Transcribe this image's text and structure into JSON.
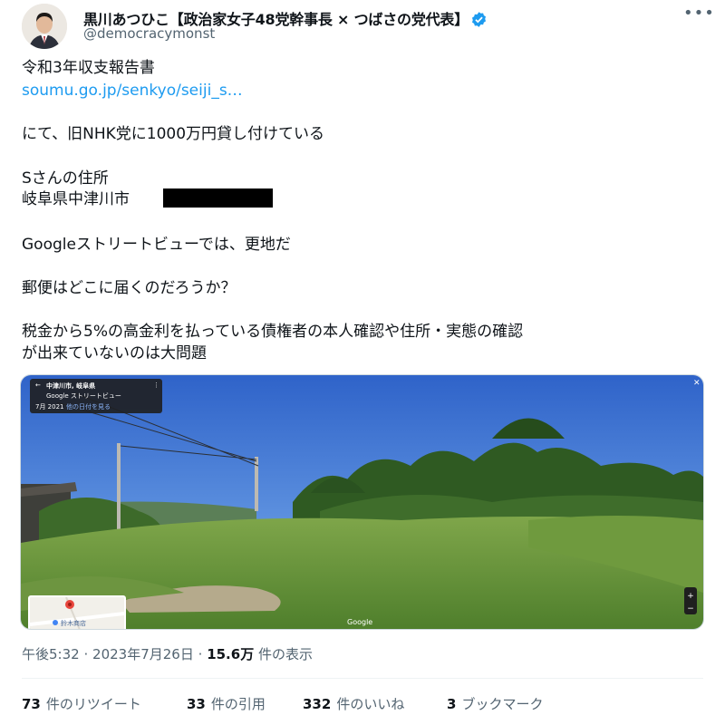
{
  "author": {
    "name": "黒川あつひこ【政治家女子48党幹事長 × つばさの党代表】",
    "handle": "@democracymonst",
    "verified_icon": "verified-badge-icon",
    "verified_color": "#1d9bf0"
  },
  "more_icon": "more-horizontal-icon",
  "post": {
    "line1": "令和3年収支報告書",
    "link": "soumu.go.jp/senkyo/seiji_s…",
    "line3": "にて、旧NHK党に1000万円貸し付けている",
    "line4": "Sさんの住所",
    "line5": "岐阜県中津川市",
    "line6": "Googleストリートビューでは、更地だ",
    "line7": "郵便はどこに届くのだろうか？",
    "line8": "税金から5%の高金利を払っている債権者の本人確認や住所・実態の確認",
    "line9": "が出来ていないのは大問題"
  },
  "media": {
    "place": "中津川市, 岐阜県",
    "provider": "Google ストリートビュー",
    "date": "7月 2021",
    "action": "他の日付を見る",
    "map_label": "鈴木商店",
    "watermark": "Google"
  },
  "meta": {
    "time": "午後5:32",
    "date": "2023年7月26日",
    "views": "15.6万",
    "views_label": "件の表示",
    "separator": "·"
  },
  "stats": {
    "retweets": "73",
    "retweets_label": "件のリツイート",
    "quotes": "33",
    "quotes_label": "件の引用",
    "likes": "332",
    "likes_label": "件のいいね",
    "bookmarks": "3",
    "bookmarks_label": "ブックマーク"
  }
}
